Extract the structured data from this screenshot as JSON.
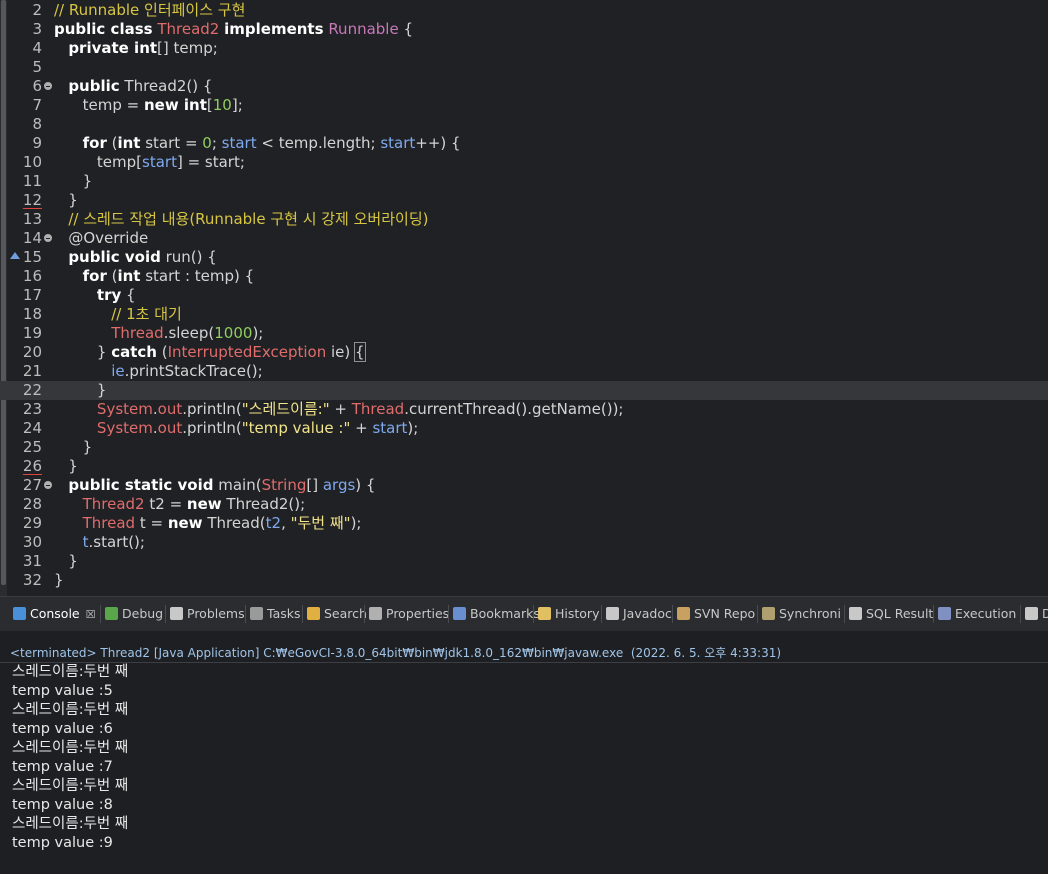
{
  "editor": {
    "lines": [
      {
        "n": "2",
        "html": "<span class=\"cm\">// Runnable 인터페이스 구현</span>"
      },
      {
        "n": "3",
        "html": "<span class=\"kw\">public class</span> <span class=\"type\">Thread2</span> <span class=\"kw\">implements</span> <span class=\"type\" style=\"color:#c678b7\">Runnable</span> {"
      },
      {
        "n": "4",
        "html": "   <span class=\"kw\">private int</span>[] temp;"
      },
      {
        "n": "5",
        "html": ""
      },
      {
        "n": "6",
        "fold": true,
        "html": "   <span class=\"kw\">public</span> Thread2() {"
      },
      {
        "n": "7",
        "html": "      temp = <span class=\"kw\">new int</span>[<span class=\"num\">10</span>];"
      },
      {
        "n": "8",
        "html": ""
      },
      {
        "n": "9",
        "html": "      <span class=\"kw\">for</span> (<span class=\"kw\">int</span> start = <span class=\"num\">0</span>; <span class=\"var\">start</span> &lt; temp.length; <span class=\"var\">start</span>++) {"
      },
      {
        "n": "10",
        "html": "         temp[<span class=\"var\">start</span>] = start;"
      },
      {
        "n": "11",
        "html": "      }"
      },
      {
        "n": "12",
        "underline": true,
        "html": "   }"
      },
      {
        "n": "13",
        "html": "   <span class=\"cm\">// 스레드 작업 내용(Runnable 구현 시 강제 오버라이딩)</span>"
      },
      {
        "n": "14",
        "fold": true,
        "html": "   <span class=\"ann\">@Override</span>"
      },
      {
        "n": "15",
        "override": true,
        "html": "   <span class=\"kw\">public void</span> run() {"
      },
      {
        "n": "16",
        "html": "      <span class=\"kw\">for</span> (<span class=\"kw\">int</span> start : temp) {"
      },
      {
        "n": "17",
        "html": "         <span class=\"kw\">try</span> {"
      },
      {
        "n": "18",
        "html": "            <span class=\"cm\">// 1초 대기</span>"
      },
      {
        "n": "19",
        "html": "            <span class=\"type\">Thread</span>.sleep(<span class=\"num\">1000</span>);"
      },
      {
        "n": "20",
        "html": "         } <span class=\"kw\">catch</span> (<span class=\"type\">InterruptedException</span> ie) <span class=\"bracket-box\">{</span>"
      },
      {
        "n": "21",
        "html": "            <span class=\"var\">ie</span>.printStackTrace();"
      },
      {
        "n": "22",
        "current": true,
        "html": "         }"
      },
      {
        "n": "23",
        "html": "         <span class=\"type\">System</span>.<span class=\"type\">out</span>.println(<span class=\"str\">\"스레드이름:\"</span> + <span class=\"type\">Thread</span>.currentThread().getName());"
      },
      {
        "n": "24",
        "html": "         <span class=\"type\">System</span>.<span class=\"type\">out</span>.println(<span class=\"str\">\"temp value :\"</span> + <span class=\"var\">start</span>);"
      },
      {
        "n": "25",
        "html": "      }"
      },
      {
        "n": "26",
        "underline": true,
        "html": "   }"
      },
      {
        "n": "27",
        "fold": true,
        "html": "   <span class=\"kw\">public static void</span> main(<span class=\"type\">String</span>[] <span class=\"var\">args</span>) {"
      },
      {
        "n": "28",
        "html": "      <span class=\"type\">Thread2</span> t2 = <span class=\"kw\">new</span> Thread2();"
      },
      {
        "n": "29",
        "html": "      <span class=\"type\">Thread</span> t = <span class=\"kw\">new</span> Thread(<span class=\"var\">t2</span>, <span class=\"str\">\"두번 째\"</span>);"
      },
      {
        "n": "30",
        "html": "      <span class=\"var\">t</span>.start();"
      },
      {
        "n": "31",
        "html": "   }"
      },
      {
        "n": "32",
        "html": "}"
      }
    ]
  },
  "tabs": [
    {
      "label": "Console",
      "icon": "console-icon",
      "color": "#4a90d9",
      "active": true,
      "closable": true
    },
    {
      "label": "Debug",
      "icon": "bug-icon",
      "color": "#5aa64a"
    },
    {
      "label": "Problems",
      "icon": "problems-icon",
      "color": "#c8c8c8"
    },
    {
      "label": "Tasks",
      "icon": "tasks-icon",
      "color": "#9a9a9a"
    },
    {
      "label": "Search",
      "icon": "search-icon",
      "color": "#e0b040"
    },
    {
      "label": "Properties",
      "icon": "properties-icon",
      "color": "#b0b0b0"
    },
    {
      "label": "Bookmarks",
      "icon": "bookmark-icon",
      "color": "#6a8fd0"
    },
    {
      "label": "History",
      "icon": "history-icon",
      "color": "#e0c060"
    },
    {
      "label": "Javadoc",
      "icon": "javadoc-icon",
      "color": "#c8c8c8"
    },
    {
      "label": "SVN Repo",
      "icon": "svn-icon",
      "color": "#c8a060"
    },
    {
      "label": "Synchroni",
      "icon": "sync-icon",
      "color": "#b0a070"
    },
    {
      "label": "SQL Result",
      "icon": "table-icon",
      "color": "#c8c8c8"
    },
    {
      "label": "Execution",
      "icon": "execution-icon",
      "color": "#8090c0"
    },
    {
      "label": "D",
      "icon": "pin-icon",
      "color": "#c8c8c8"
    }
  ],
  "console": {
    "status": "<terminated> Thread2 [Java Application] C:₩eGovCI-3.8.0_64bit₩bin₩jdk1.8.0_162₩bin₩javaw.exe  (2022. 6. 5. 오후 4:33:31)",
    "lines": [
      "스레드이름:두번 째",
      "temp value :5",
      "스레드이름:두번 째",
      "temp value :6",
      "스레드이름:두번 째",
      "temp value :7",
      "스레드이름:두번 째",
      "temp value :8",
      "스레드이름:두번 째",
      "temp value :9"
    ]
  }
}
